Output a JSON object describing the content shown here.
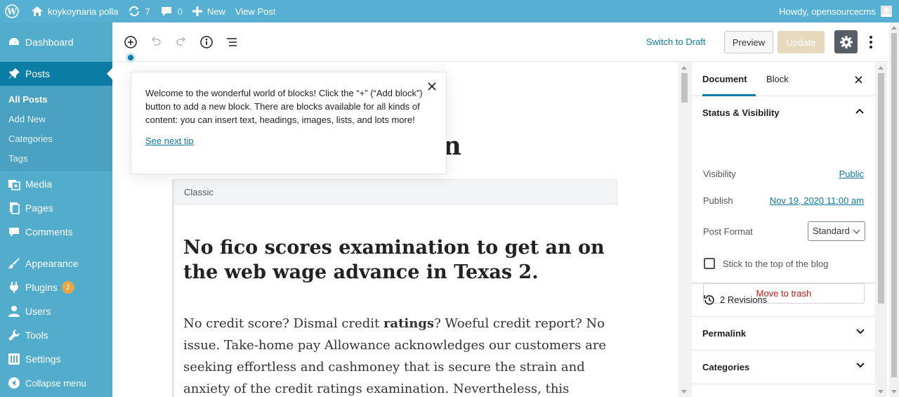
{
  "adminbar": {
    "site_name": "koykoynaria polla",
    "updates_count": "7",
    "comments_count": "0",
    "new_label": "New",
    "view_post_label": "View Post",
    "howdy": "Howdy, opensourcecms"
  },
  "sidebar": {
    "dashboard": "Dashboard",
    "posts": "Posts",
    "sub": [
      "All Posts",
      "Add New",
      "Categories",
      "Tags"
    ],
    "media": "Media",
    "pages": "Pages",
    "comments": "Comments",
    "appearance": "Appearance",
    "plugins": "Plugins",
    "plugins_badge": "2",
    "users": "Users",
    "tools": "Tools",
    "settings": "Settings",
    "collapse": "Collapse menu"
  },
  "header": {
    "switch_draft": "Switch to Draft",
    "preview": "Preview",
    "update": "Update"
  },
  "tip": {
    "text": "Welcome to the wonderful world of blocks! Click the “+” (“Add block”) button to add a new block. There are blocks available for all kinds of content: you can insert text, headings, images, lists, and lots more!",
    "next": "See next tip"
  },
  "content": {
    "title_fragment": "ton",
    "classic_label": "Classic",
    "heading": "No fico scores examination to get an on the web wage advance in Texas 2.",
    "para_before": "No credit score? Dismal credit ",
    "para_bold": "ratings",
    "para_after": "? Woeful credit report? No issue. Take-home pay Allowance acknowledges our customers are seeking effortless and cashmoney that is secure the strain and anxiety of the credit ratings examination. Nevertheless, this"
  },
  "settings": {
    "tab_document": "Document",
    "tab_block": "Block",
    "status_title": "Status & Visibility",
    "visibility_label": "Visibility",
    "visibility_value": "Public",
    "publish_label": "Publish",
    "publish_value": "Nov 19, 2020 11:00 am",
    "format_label": "Post Format",
    "format_value": "Standard",
    "stick_label": "Stick to the top of the blog",
    "trash": "Move to trash",
    "revisions": "2 Revisions",
    "permalink": "Permalink",
    "categories": "Categories"
  },
  "colors": {
    "adminbar": "#55b0d3",
    "sidebar": "#52accc",
    "current": "#0b7ca3",
    "accent": "#0b7ca3"
  }
}
